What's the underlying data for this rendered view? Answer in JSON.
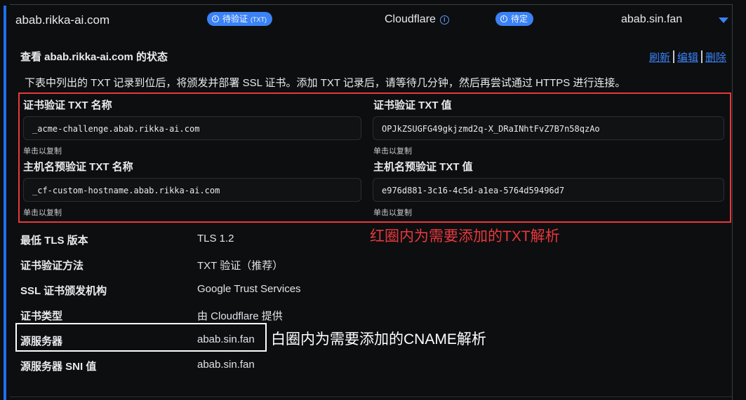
{
  "row": {
    "domain": "abab.rikka-ai.com",
    "verify_badge": "待验证",
    "verify_badge_sub": "(TXT)",
    "provider": "Cloudflare",
    "status_badge": "待定",
    "target": "abab.sin.fan"
  },
  "status": {
    "title": "查看 abab.rikka-ai.com 的状态",
    "actions": {
      "refresh": "刷新",
      "edit": "编辑",
      "delete": "删除"
    },
    "description": "下表中列出的 TXT 记录到位后，将颁发并部署 SSL 证书。添加 TXT 记录后，请等待几分钟，然后再尝试通过 HTTPS 进行连接。"
  },
  "txt_records": {
    "cert_name_label": "证书验证 TXT 名称",
    "cert_name_value": "_acme-challenge.abab.rikka-ai.com",
    "cert_value_label": "证书验证 TXT 值",
    "cert_value_value": "OPJkZSUGFG49gkjzmd2q-X_DRaINhtFvZ7B7n58qzAo",
    "host_name_label": "主机名预验证 TXT 名称",
    "host_name_value": "_cf-custom-hostname.abab.rikka-ai.com",
    "host_value_label": "主机名预验证 TXT 值",
    "host_value_value": "e976d881-3c16-4c5d-a1ea-5764d59496d7",
    "copy_hint": "单击以复制"
  },
  "annotations": {
    "red_note": "红圈内为需要添加的TXT解析",
    "white_note": "白圈内为需要添加的CNAME解析"
  },
  "details": [
    {
      "label": "最低 TLS 版本",
      "value": "TLS 1.2"
    },
    {
      "label": "证书验证方法",
      "value": "TXT 验证（推荐）"
    },
    {
      "label": "SSL 证书颁发机构",
      "value": "Google Trust Services"
    },
    {
      "label": "证书类型",
      "value": "由 Cloudflare 提供"
    },
    {
      "label": "源服务器",
      "value": "abab.sin.fan"
    },
    {
      "label": "源服务器 SNI 值",
      "value": "abab.sin.fan"
    }
  ],
  "colors": {
    "accent": "#3b82f6",
    "red_annotation": "#e8383d",
    "white_annotation": "#ffffff",
    "background": "#0d0e10"
  }
}
